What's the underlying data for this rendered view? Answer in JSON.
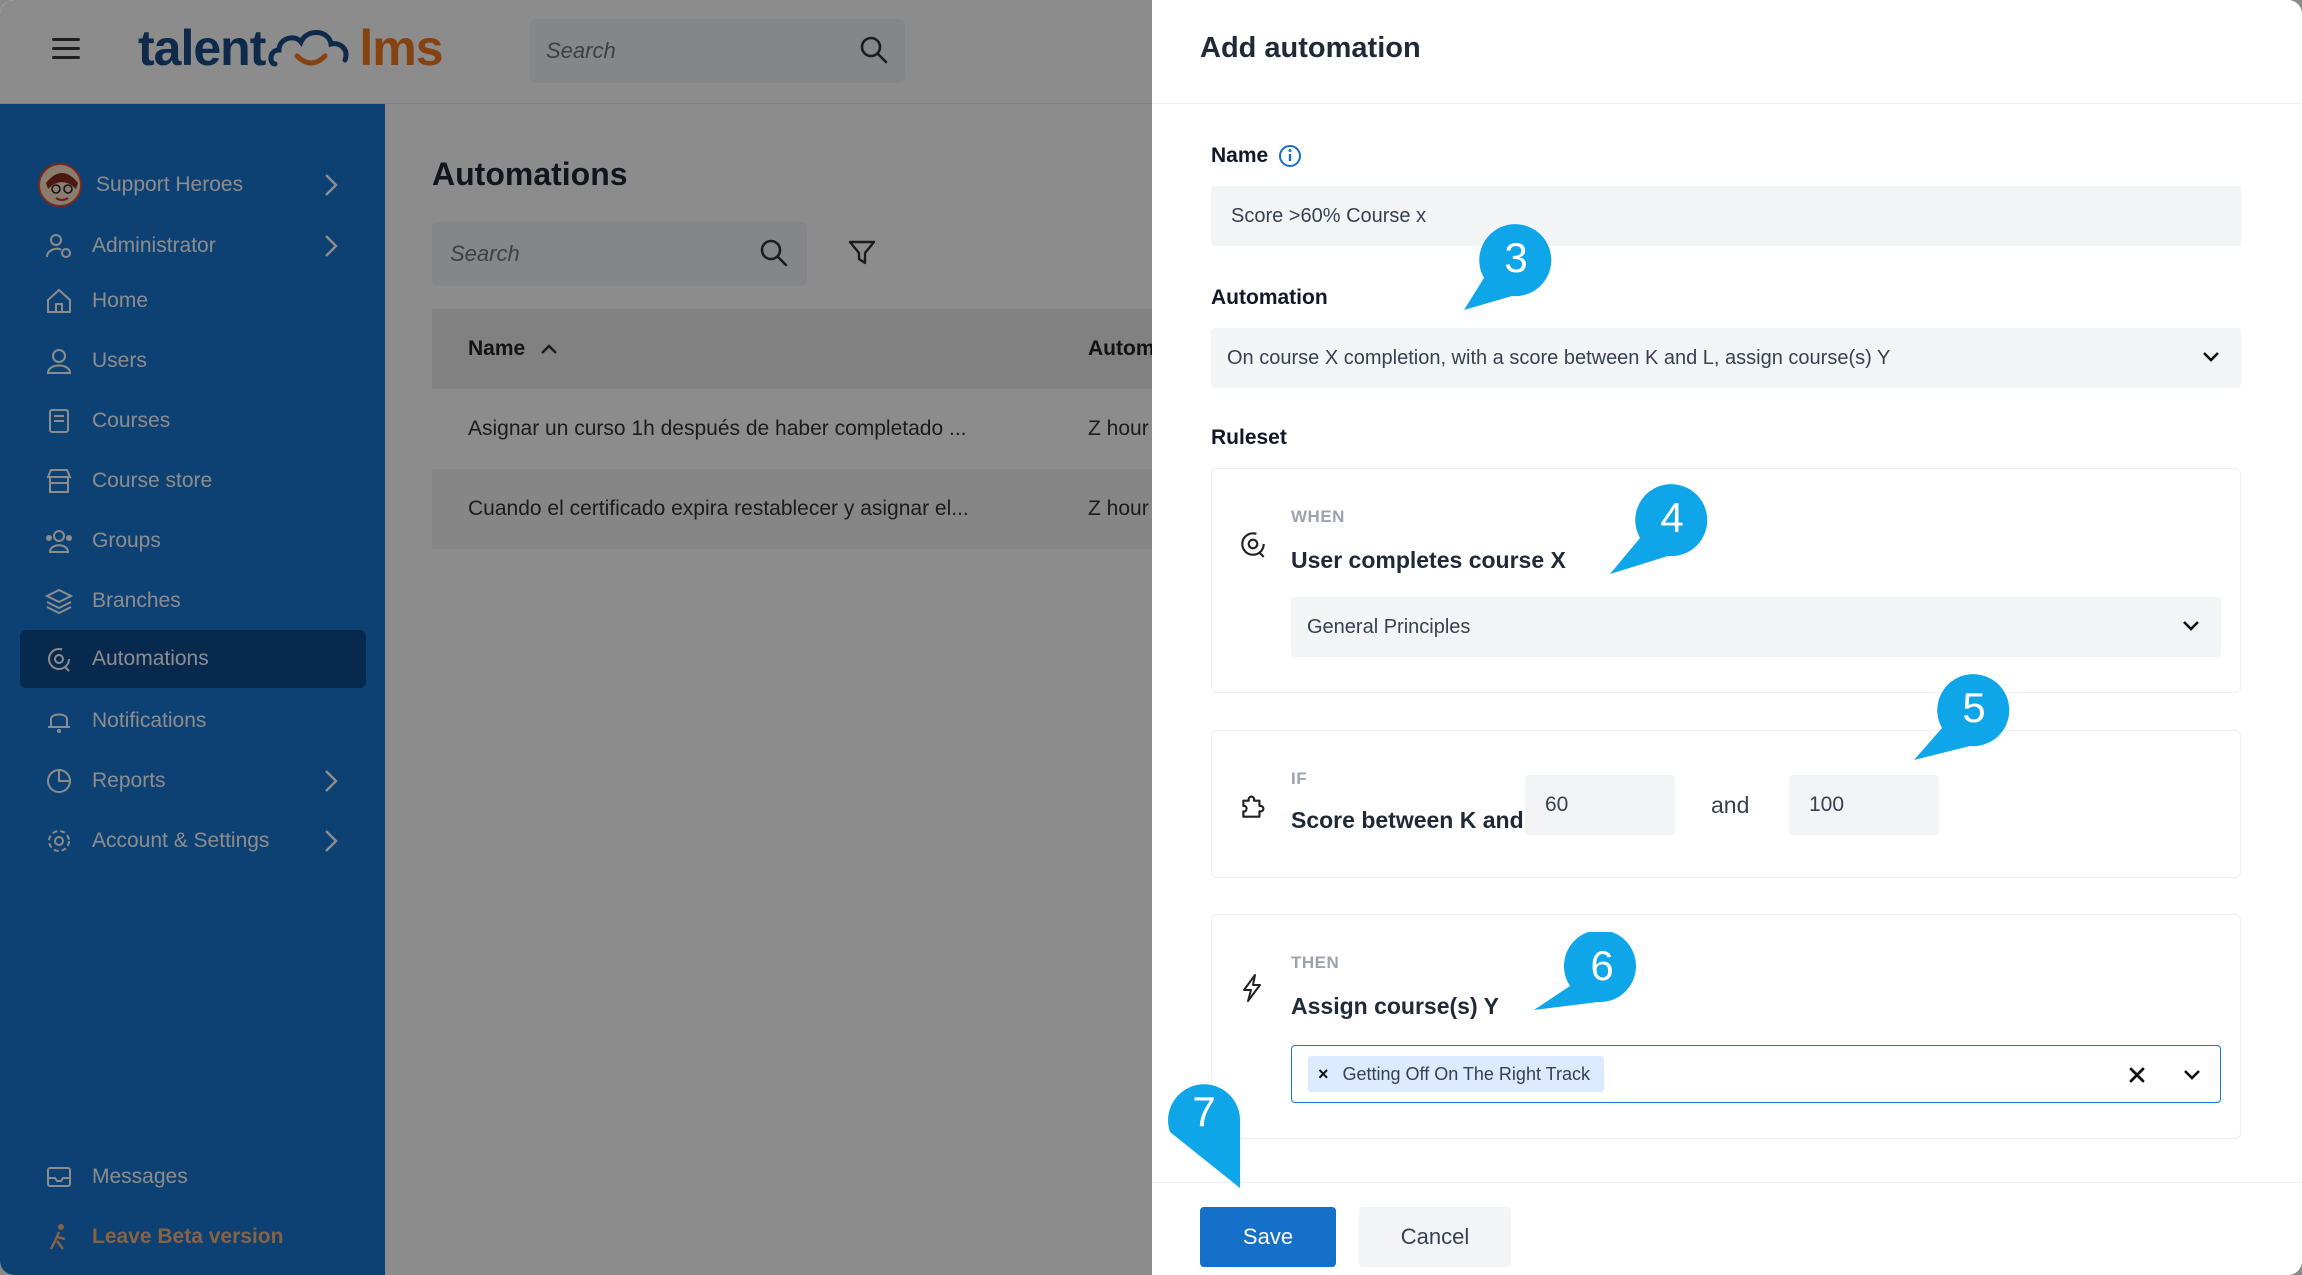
{
  "colors": {
    "sidebar": "#1976d2",
    "sidebar_active": "#0e4b8c",
    "accent": "#1470c9",
    "callout": "#0ea5e9",
    "logo_blue": "#1c4c87",
    "logo_orange": "#f47b20"
  },
  "logo": {
    "part1": "talent",
    "part2": "lms"
  },
  "top_search": {
    "placeholder": "Search"
  },
  "sidebar": {
    "user": "Support Heroes",
    "role": "Administrator",
    "items": [
      {
        "label": "Home",
        "icon": "home-icon"
      },
      {
        "label": "Users",
        "icon": "user-icon"
      },
      {
        "label": "Courses",
        "icon": "book-icon"
      },
      {
        "label": "Course store",
        "icon": "store-icon"
      },
      {
        "label": "Groups",
        "icon": "groups-icon"
      },
      {
        "label": "Branches",
        "icon": "layers-icon"
      },
      {
        "label": "Automations",
        "icon": "automation-icon"
      },
      {
        "label": "Notifications",
        "icon": "bell-icon"
      },
      {
        "label": "Reports",
        "icon": "pie-chart-icon"
      },
      {
        "label": "Account & Settings",
        "icon": "gear-icon"
      }
    ],
    "messages": "Messages",
    "leave_beta": "Leave Beta version"
  },
  "main": {
    "title": "Automations",
    "search_placeholder": "Search",
    "columns": {
      "name": "Name",
      "automation": "Autom"
    },
    "rows": [
      {
        "name": "Asignar un curso 1h después de haber completado ...",
        "automation": "Z hour"
      },
      {
        "name": "Cuando el certificado expira restablecer y asignar el...",
        "automation": "Z hour"
      }
    ]
  },
  "drawer": {
    "title": "Add automation",
    "name_label": "Name",
    "name_value": "Score >60% Course x",
    "automation_label": "Automation",
    "automation_value": "On course X completion, with a score between K and L, assign course(s) Y",
    "ruleset_label": "Ruleset",
    "when": {
      "cap": "WHEN",
      "title": "User completes course X",
      "value": "General Principles"
    },
    "if": {
      "cap": "IF",
      "title": "Score between K and L",
      "min": "60",
      "and": "and",
      "max": "100"
    },
    "then": {
      "cap": "THEN",
      "title": "Assign course(s) Y",
      "tag": "Getting Off On The Right Track"
    },
    "save": "Save",
    "cancel": "Cancel"
  },
  "callouts": [
    "3",
    "4",
    "5",
    "6",
    "7"
  ]
}
